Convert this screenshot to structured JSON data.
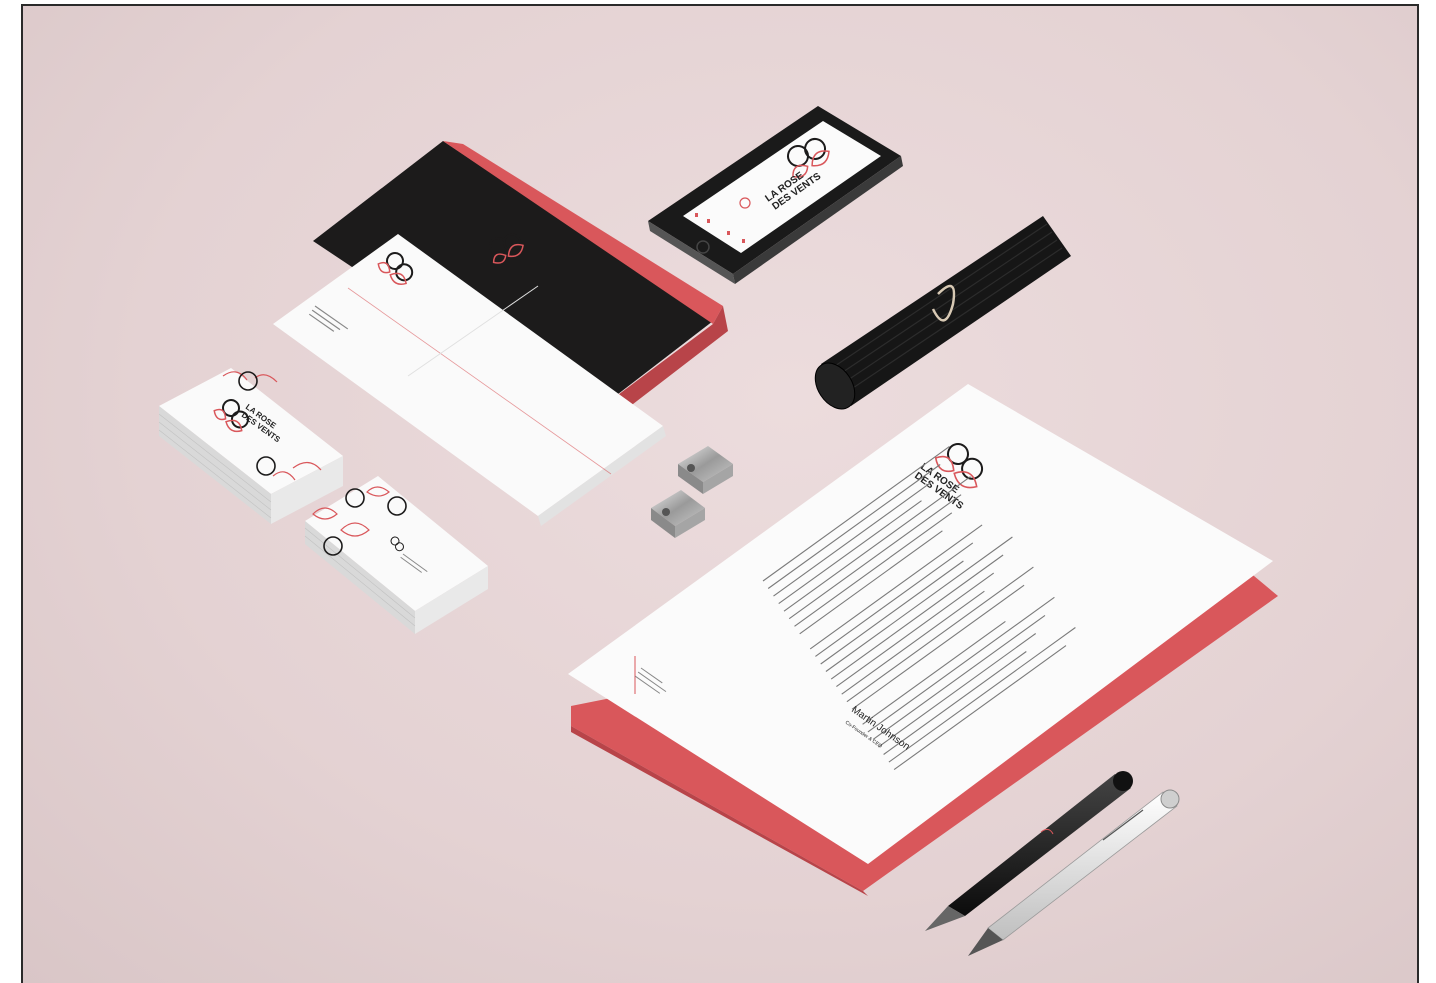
{
  "brand": {
    "line1": "LA ROSE",
    "line2": "DES VENTS"
  },
  "letterhead": {
    "signature_name": "Martin Johnson",
    "signature_title": "Co-Founder & CEO"
  },
  "colors": {
    "background": "#e6d5d6",
    "accent": "#d9575b",
    "dark": "#1c1b1b",
    "paper": "#fbfbfb"
  }
}
